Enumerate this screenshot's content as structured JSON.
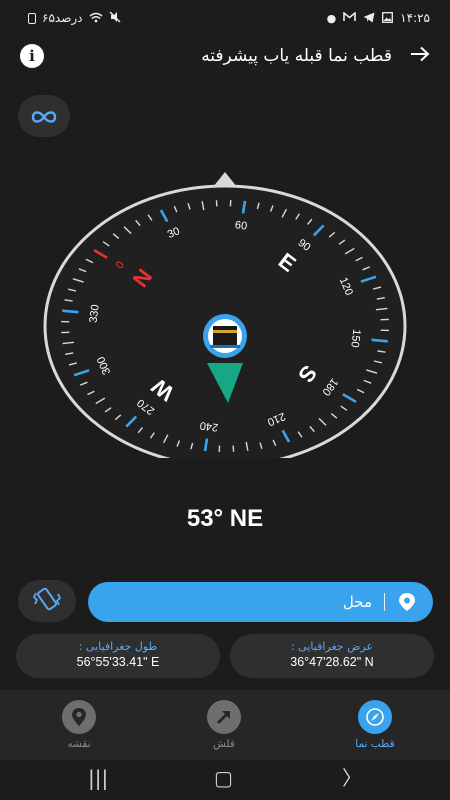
{
  "status_bar": {
    "time": "۱۴:۲۵",
    "battery": "۶۵درصد",
    "icons": [
      "battery-icon",
      "wifi-icon",
      "mute-icon",
      "telegram-icon",
      "gmail-icon",
      "gallery-icon",
      "notification-dot-icon"
    ]
  },
  "header": {
    "title": "قطب نما قبله یاب پیشرفته",
    "info_icon": "info-icon",
    "back_icon": "arrow-right-icon"
  },
  "calibrate_icon": "infinity-icon",
  "compass": {
    "heading_deg": 53,
    "cardinals": [
      "N",
      "E",
      "S",
      "W"
    ],
    "degree_labels": [
      "0",
      "30",
      "60",
      "90",
      "120",
      "150",
      "180",
      "210",
      "240",
      "270",
      "300",
      "330"
    ],
    "accent_color": "#3aa3ee",
    "north_color": "#e8322e",
    "needle_color": "#16a884"
  },
  "heading_readout": "53° NE",
  "location_button": {
    "label": "محل",
    "icon": "location-pin-icon"
  },
  "vibration_icon": "vibrate-icon",
  "coordinates": {
    "longitude_label": "طول جغرافیایی :",
    "longitude_value": "56°55'33.41\" E",
    "latitude_label": "عرض جغرافیایی :",
    "latitude_value": "36°47'28.62\" N"
  },
  "bottom_nav": {
    "map": "نقشه",
    "arrow": "فلش",
    "compass": "قطب نما"
  },
  "system_nav": {
    "recents": "|||",
    "home": "▢",
    "back": "〉"
  }
}
